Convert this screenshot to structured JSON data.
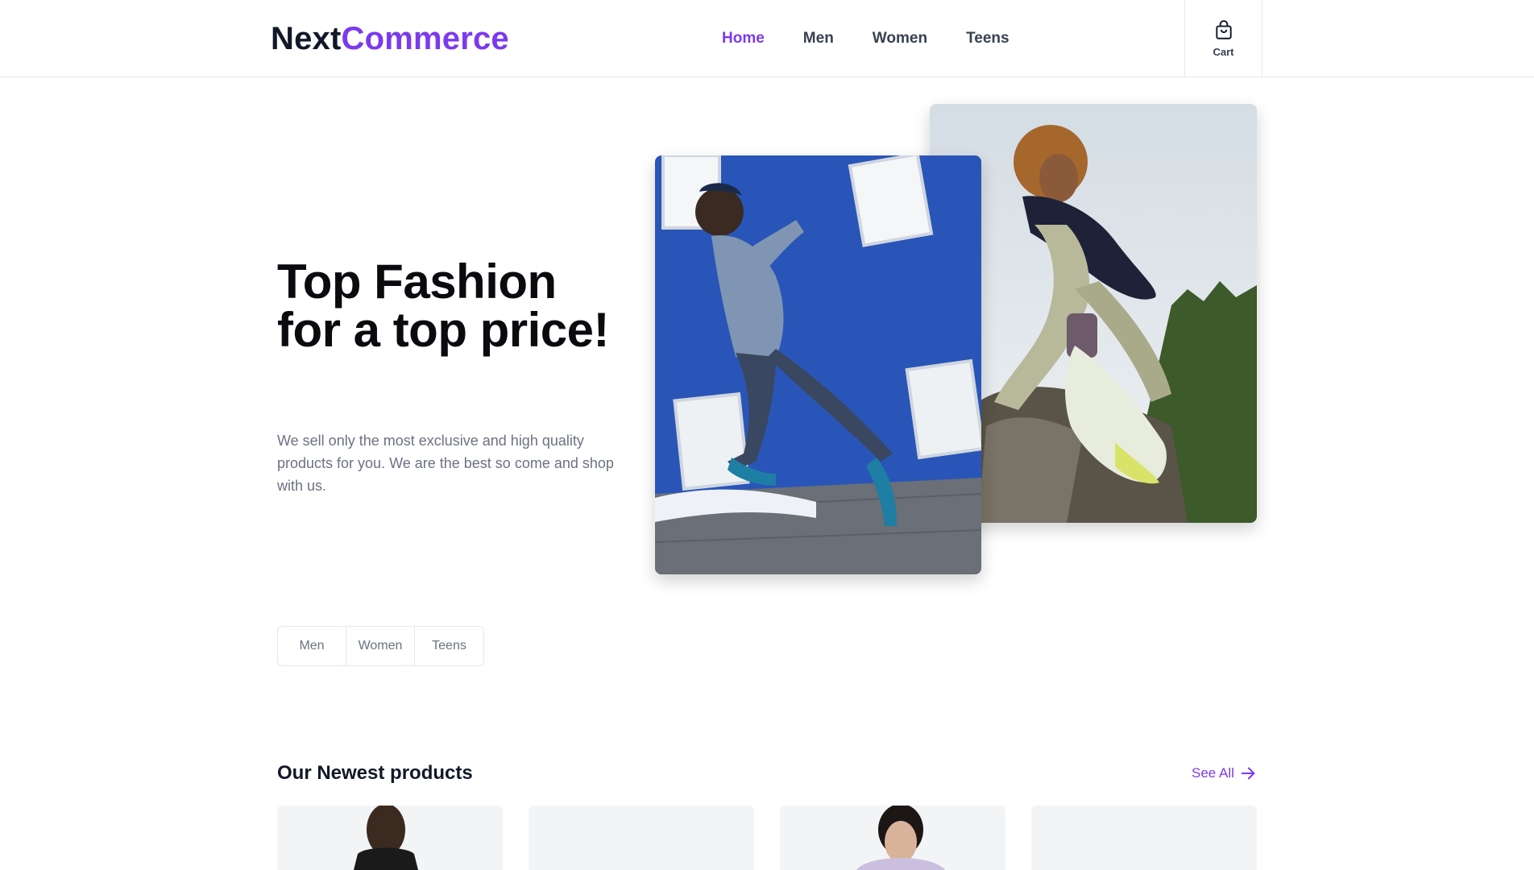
{
  "brand": {
    "part1": "Next",
    "part2": "Commerce",
    "accent_color": "#7c3aed"
  },
  "nav": {
    "items": [
      {
        "label": "Home",
        "active": true
      },
      {
        "label": "Men"
      },
      {
        "label": "Women"
      },
      {
        "label": "Teens"
      }
    ]
  },
  "cart": {
    "label": "Cart",
    "icon": "shopping-bag-icon"
  },
  "hero": {
    "title": "Top Fashion for a top price!",
    "description": "We sell only the most exclusive and high quality products for you. We are the best so come and shop with us."
  },
  "categories": {
    "items": [
      "Men",
      "Women",
      "Teens"
    ]
  },
  "newest": {
    "title": "Our Newest products",
    "see_all_label": "See All"
  }
}
